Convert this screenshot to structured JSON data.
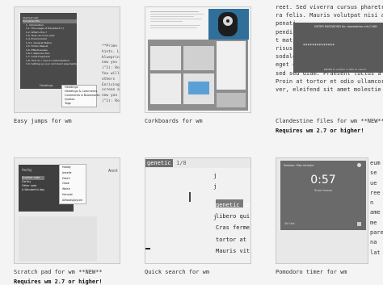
{
  "captions": {
    "c1": "Easy jumps for wm",
    "c2": "Corkboards for wm",
    "c3": "Clandestine files for wm **NEW**",
    "c3_req": "Requires wm 2.7 or higher!",
    "c4": "Scratch pad for wm **NEW**",
    "c4_req": "Requires wm 2.7 or higher!",
    "c5": "Quick search for wm",
    "c6": "Pomodoro timer for wm"
  },
  "thumb1": {
    "tree_items": [
      "Abstract text",
      "Formatted file",
      "1. Introduction",
      "1.1. The usage of Precedent (*)",
      "1.2. What's this ?",
      "1.3. How can it be used",
      "1.4. Environment",
      "1.4.1. General Status",
      "1.5. Folder Paquet",
      "1.6. Effectiveness",
      "1.6.1. Reproduction",
      "1.7. Code Fragment",
      "1.8. How do I unlock customization?",
      "1.9. Setting up your command arguments"
    ],
    "bottom_label": "Headings",
    "menu": [
      "Headings",
      "Headings & Comments",
      "Comments & Bookmarks",
      "Quotes",
      "Tags"
    ],
    "text_lines": [
      "**Primo",
      "hints. L",
      "blueprin",
      "now you",
      "(\"1): Ro",
      "You will",
      "others",
      "Enriving",
      "screen a",
      "now you",
      "(\"1): Ro"
    ]
  },
  "thumb2": {},
  "thumb3": {
    "bg_lines": [
      "reet. Sed viverra cursus pharetra. Nam",
      "ra felis. Mauris volutpat nisi at purus",
      "",
      "penati",
      "pendis",
      "t mat",
      "risus",
      "sodales sed, mattis eget sapien. Mauris",
      "eget eget, gravida et enim. Suspendisse",
      "sed sed diam. Praesent luctus a quam.",
      "Proin at tortor et odio ullamcorper accu",
      "ver, eleifend sit amet molestie sed."
    ],
    "dialog_title": "ENTER PASSWORD for clandestine mit.CLND",
    "dialog_mask": "**************",
    "dialog_hint": "ENTER to confirm or ESC to cancel"
  },
  "thumb4": {
    "title": "Anchy",
    "items": [
      "Another note",
      "Zarthy",
      "Other note",
      "A Wonderful day"
    ],
    "menu": [
      "Hobby",
      "Jewelle",
      "Hatch",
      "Oboe",
      "Welsh",
      "Harvest",
      "Allfoods/Jaycee"
    ],
    "side": "Anot"
  },
  "thumb5": {
    "search": "genetic",
    "search_hint": "1/8",
    "result_lines": [
      "genetic Lo",
      "libero qui",
      "Cras ferme",
      "tortor at",
      "Mauris vit"
    ],
    "cursor_lines": [
      "j",
      "j",
      "j"
    ]
  },
  "thumb6": {
    "header": "Session: files rename",
    "time": "0:57",
    "label": "Short break",
    "footer": "Ski this",
    "right_lines": [
      "eum",
      "se",
      "ue",
      "ree",
      "n",
      "ame",
      "me",
      "pare",
      "na",
      "lat"
    ]
  }
}
